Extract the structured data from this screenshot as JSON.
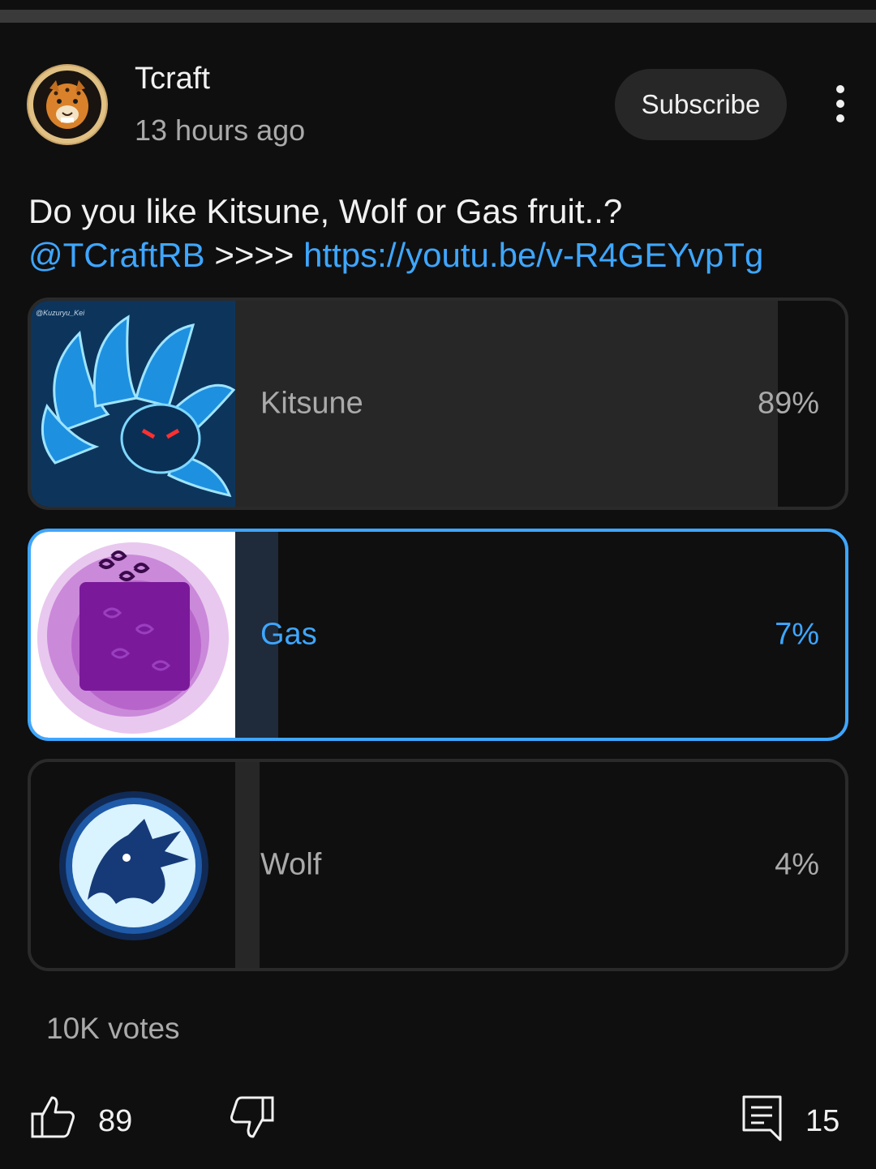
{
  "post": {
    "channel_name": "Tcraft",
    "time_ago": "13 hours ago",
    "subscribe_label": "Subscribe",
    "text_line1": "Do you like Kitsune, Wolf or Gas fruit..?",
    "mention": "@TCraftRB",
    "arrows": " >>>> ",
    "url": "https://youtu.be/v-R4GEYvpTg"
  },
  "poll": {
    "options": [
      {
        "label": "Kitsune",
        "percent_text": "89%",
        "percent": 89,
        "thumb_caption": "@Kuzuryu_Kei",
        "selected": false
      },
      {
        "label": "Gas",
        "percent_text": "7%",
        "percent": 7,
        "selected": true
      },
      {
        "label": "Wolf",
        "percent_text": "4%",
        "percent": 4,
        "selected": false
      }
    ],
    "votes": "10K votes"
  },
  "actions": {
    "likes": "89",
    "comments": "15"
  },
  "colors": {
    "background": "#0f0f0f",
    "accent": "#3ea6ff",
    "bar": "#272727"
  }
}
